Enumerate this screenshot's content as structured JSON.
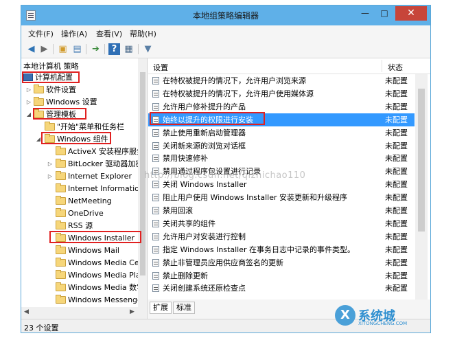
{
  "window": {
    "title": "本地组策略编辑器",
    "minimize": "—",
    "maximize": "□",
    "close": "✕"
  },
  "menu": [
    "文件(F)",
    "操作(A)",
    "查看(V)",
    "帮助(H)"
  ],
  "toolbar": {
    "icons": [
      "back-arrow-icon",
      "forward-arrow-icon",
      "folder-up-icon",
      "show-hide-tree-icon",
      "export-list-icon",
      "help-icon",
      "properties-icon",
      "filter-icon"
    ]
  },
  "tree": {
    "header": "本地计算机 策略",
    "items": [
      {
        "label": "计算机配置",
        "expanded": true
      },
      {
        "label": "软件设置"
      },
      {
        "label": "Windows 设置"
      },
      {
        "label": "管理模板",
        "expanded": true
      },
      {
        "label": "\"开始\"菜单和任务栏"
      },
      {
        "label": "Windows 组件",
        "expanded": true
      },
      {
        "label": "ActiveX 安装程序服务"
      },
      {
        "label": "BitLocker 驱动器加密"
      },
      {
        "label": "Internet Explorer"
      },
      {
        "label": "Internet Information"
      },
      {
        "label": "NetMeeting"
      },
      {
        "label": "OneDrive"
      },
      {
        "label": "RSS 源"
      },
      {
        "label": "Windows Installer",
        "selected": true
      },
      {
        "label": "Windows Mail"
      },
      {
        "label": "Windows Media Center"
      },
      {
        "label": "Windows Media Player"
      },
      {
        "label": "Windows Media 数字"
      },
      {
        "label": "Windows Messenger"
      }
    ]
  },
  "list": {
    "columns": {
      "setting": "设置",
      "state": "状态"
    },
    "rows": [
      {
        "name": "在特权被提升的情况下，允许用户浏览来源",
        "state": "未配置"
      },
      {
        "name": "在特权被提升的情况下，允许用户使用媒体源",
        "state": "未配置"
      },
      {
        "name": "允许用户修补提升的产品",
        "state": "未配置"
      },
      {
        "name": "始终以提升的权限进行安装",
        "state": "未配置",
        "selected": true
      },
      {
        "name": "禁止使用重新启动管理器",
        "state": "未配置"
      },
      {
        "name": "关闭新来源的浏览对话框",
        "state": "未配置"
      },
      {
        "name": "禁用快速修补",
        "state": "未配置"
      },
      {
        "name": "禁用通过程序包设置进行记录",
        "state": "未配置"
      },
      {
        "name": "关闭 Windows Installer",
        "state": "未配置"
      },
      {
        "name": "阻止用户使用 Windows Installer 安装更新和升级程序",
        "state": "未配置"
      },
      {
        "name": "禁用回滚",
        "state": "未配置"
      },
      {
        "name": "关闭共享的组件",
        "state": "未配置"
      },
      {
        "name": "允许用户对安装进行控制",
        "state": "未配置"
      },
      {
        "name": "指定 Windows Installer 在事务日志中记录的事件类型。",
        "state": "未配置"
      },
      {
        "name": "禁止非管理员应用供应商签名的更新",
        "state": "未配置"
      },
      {
        "name": "禁止删除更新",
        "state": "未配置"
      },
      {
        "name": "关闭创建系统还原检查点",
        "state": "未配置"
      }
    ]
  },
  "tabs": [
    "扩展",
    "标准"
  ],
  "status": "23 个设置",
  "watermark": "http://blog.csdn.net/qizhichao110",
  "logo": {
    "mark": "X",
    "text": "系统城",
    "sub": "XITONGCHENG.COM"
  },
  "colors": {
    "titlebar": "#5fb0e8",
    "selection": "#3399ff",
    "highlight_box": "#e02020",
    "close_button": "#c7453a"
  }
}
